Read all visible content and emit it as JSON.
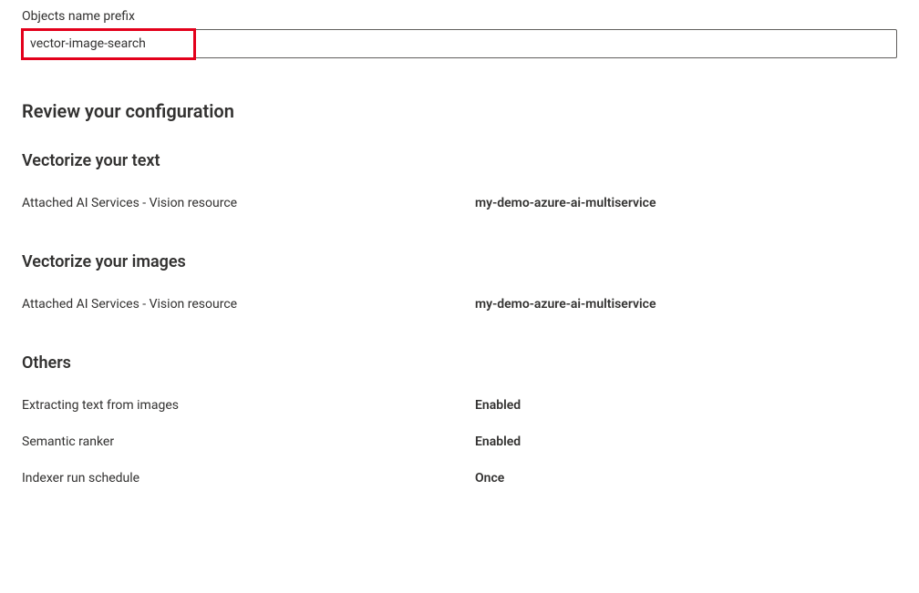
{
  "prefixField": {
    "label": "Objects name prefix",
    "value": "vector-image-search"
  },
  "reviewHeading": "Review your configuration",
  "vectorizeText": {
    "heading": "Vectorize your text",
    "rows": [
      {
        "label": "Attached AI Services - Vision resource",
        "value": "my-demo-azure-ai-multiservice"
      }
    ]
  },
  "vectorizeImages": {
    "heading": "Vectorize your images",
    "rows": [
      {
        "label": "Attached AI Services - Vision resource",
        "value": "my-demo-azure-ai-multiservice"
      }
    ]
  },
  "others": {
    "heading": "Others",
    "rows": [
      {
        "label": "Extracting text from images",
        "value": "Enabled"
      },
      {
        "label": "Semantic ranker",
        "value": "Enabled"
      },
      {
        "label": "Indexer run schedule",
        "value": "Once"
      }
    ]
  }
}
